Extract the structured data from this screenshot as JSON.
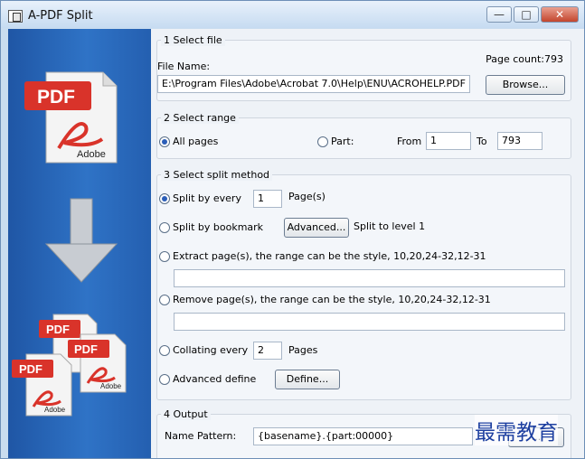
{
  "window": {
    "title": "A-PDF Split"
  },
  "titlebar": {
    "minimize": "—",
    "maximize": "□",
    "close": "✕"
  },
  "icons": {
    "pdf_text": "PDF",
    "adobe_text": "Adobe",
    "arrow": "down-arrow",
    "colors": {
      "pdf_red": "#d9332a",
      "panel_blue": "#2f73c6"
    }
  },
  "select_file": {
    "title": "1 Select file",
    "file_label": "File Name:",
    "file_value": "E:\\Program Files\\Adobe\\Acrobat 7.0\\Help\\ENU\\ACROHELP.PDF",
    "page_count": "Page count:793",
    "browse": "Browse..."
  },
  "select_range": {
    "title": "2 Select range",
    "all_pages": "All pages",
    "part": "Part:",
    "from_label": "From",
    "from_value": "1",
    "to_label": "To",
    "to_value": "793"
  },
  "split_method": {
    "title": "3 Select split method",
    "split_every": "Split by every",
    "split_every_value": "1",
    "pages_unit": "Page(s)",
    "split_bookmark": "Split by bookmark",
    "advanced": "Advanced...",
    "split_level": "Split to level 1",
    "extract": "Extract page(s), the range can be the style, 10,20,24-32,12-31",
    "remove": "Remove page(s), the range can be the style, 10,20,24-32,12-31",
    "collating": "Collating every",
    "collating_value": "2",
    "collating_unit": "Pages",
    "advanced_define": "Advanced define",
    "define": "Define..."
  },
  "output": {
    "title": "4 Output",
    "name_pattern_label": "Name Pattern:",
    "name_pattern_value": "{basename}.{part:00000}",
    "pattern_button": "..."
  },
  "watermark": "最需教育"
}
